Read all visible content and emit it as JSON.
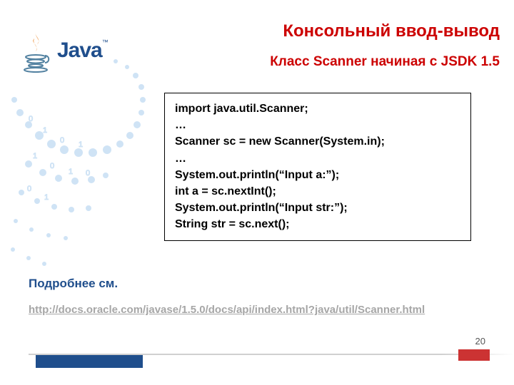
{
  "header": {
    "title": "Консольный ввод-вывод",
    "subtitle": "Класс Scanner начиная с JSDK 1.5"
  },
  "logo": {
    "word": "Java",
    "tm": "™"
  },
  "code": {
    "l1": "import java.util.Scanner;",
    "l2": "…",
    "l3": "Scanner sc = new Scanner(System.in);",
    "l4": "…",
    "l5": "System.out.println(“Input a:”);",
    "l6": "int a = sc.nextInt();",
    "l7": "System.out.println(“Input str:”);",
    "l8": "String str = sc.next();"
  },
  "more": {
    "label": "Подробнее см.",
    "url": "http://docs.oracle.com/javase/1.5.0/docs/api/index.html?java/util/Scanner.html"
  },
  "page": "20"
}
